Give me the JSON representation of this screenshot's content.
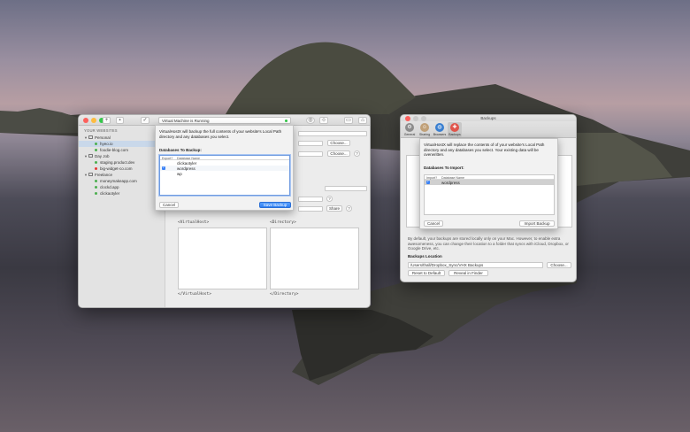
{
  "colors": {
    "accent": "#3b82f6",
    "running_dot": "#34c84a",
    "close": "#fc605c",
    "minimize": "#fdbc40",
    "zoom": "#34c84a"
  },
  "main_window": {
    "status_text": "Virtual Machine is Running",
    "sidebar": {
      "heading": "YOUR WEBSITES",
      "groups": [
        {
          "name": "Personal",
          "sites": [
            {
              "name": "hyeo.io",
              "color": "#4caf50"
            },
            {
              "name": "foodie-blog.com",
              "color": "#4caf50"
            }
          ]
        },
        {
          "name": "Day Job",
          "sites": [
            {
              "name": "staging.product.dev",
              "color": "#4caf50"
            },
            {
              "name": "big-widget-co.com",
              "color": "#e53935"
            }
          ]
        },
        {
          "name": "Freelance",
          "sites": [
            {
              "name": "moneymakeapp.com",
              "color": "#4caf50"
            },
            {
              "name": "clockd.app",
              "color": "#4caf50"
            },
            {
              "name": "clickaotyler",
              "color": "#4caf50"
            }
          ]
        }
      ]
    },
    "buttons": {
      "choose_1": "Choose...",
      "choose_2": "Choose...",
      "share": "Share",
      "help": "?"
    },
    "config": {
      "virtualhost_open": "<VirtualHost>",
      "directory_open": "<Directory>",
      "virtualhost_close": "</VirtualHost>",
      "directory_close": "</Directory>"
    }
  },
  "backup_sheet": {
    "description": "VirtualHostX will backup the full contents of your website's Local Path directory and any databases you select.",
    "table_title": "Databases To Backup:",
    "columns": [
      "Export?",
      "Database Name"
    ],
    "rows": [
      {
        "name": "clickaotyler",
        "checked": false
      },
      {
        "name": "wordpress",
        "checked": true
      },
      {
        "name": "wp",
        "checked": false
      }
    ],
    "cancel": "Cancel",
    "save": "Save Backup"
  },
  "backups_window": {
    "title": "Backups",
    "tabs": [
      {
        "label": "General",
        "icon": "gear-icon",
        "color": "#8c8c8c"
      },
      {
        "label": "Sharing",
        "icon": "sharing-icon",
        "color": "#c0a078"
      },
      {
        "label": "Browsers",
        "icon": "globe-icon",
        "color": "#3a7fd0"
      },
      {
        "label": "Backups",
        "icon": "lifebuoy-icon",
        "color": "#e0544a"
      }
    ],
    "info_text": "By default, your backups are stored locally only on your Mac. However, to enable extra awesomeness, you can change their location to a folder that syncs with iCloud, Dropbox, or Google Drive, etc.",
    "location_label": "Backups Location",
    "location_path": "/Users/thall/Dropbox_Sync/VHX Backups",
    "choose": "Choose...",
    "reset": "Reset to Default",
    "reveal": "Reveal in Finder"
  },
  "import_sheet": {
    "description": "VirtualHostX will replace the contents of of your website's Local Path directory and any databases you select. Your existing data will be overwritten.",
    "table_title": "Databases To Import:",
    "columns": [
      "Import?",
      "Database Name"
    ],
    "rows": [
      {
        "name": "wordpress",
        "checked": true
      }
    ],
    "cancel": "Cancel",
    "import": "Import Backup"
  }
}
